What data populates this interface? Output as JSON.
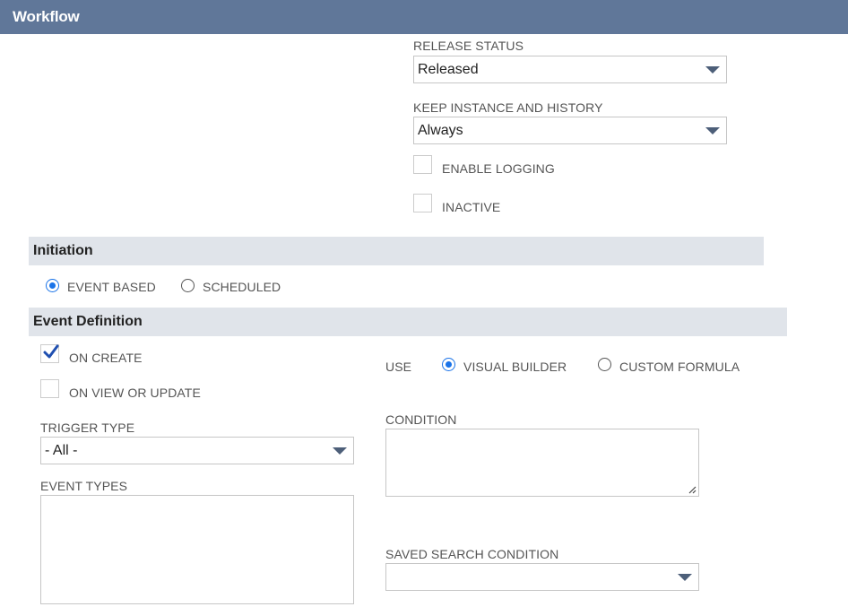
{
  "header": {
    "title": "Workflow"
  },
  "release_status": {
    "label": "RELEASE STATUS",
    "value": "Released"
  },
  "keep_instance": {
    "label": "KEEP INSTANCE AND HISTORY",
    "value": "Always"
  },
  "enable_logging": {
    "label": "ENABLE LOGGING",
    "checked": false
  },
  "inactive": {
    "label": "INACTIVE",
    "checked": false
  },
  "initiation": {
    "title": "Initiation",
    "options": [
      {
        "label": "EVENT BASED",
        "selected": true
      },
      {
        "label": "SCHEDULED",
        "selected": false
      }
    ]
  },
  "event_definition": {
    "title": "Event Definition",
    "on_create": {
      "label": "ON CREATE",
      "checked": true
    },
    "on_view_or_update": {
      "label": "ON VIEW OR UPDATE",
      "checked": false
    },
    "use": {
      "label": "USE",
      "options": [
        {
          "label": "VISUAL BUILDER",
          "selected": true
        },
        {
          "label": "CUSTOM FORMULA",
          "selected": false
        }
      ]
    },
    "trigger_type": {
      "label": "TRIGGER TYPE",
      "value": "- All -"
    },
    "condition": {
      "label": "CONDITION",
      "value": ""
    },
    "event_types": {
      "label": "EVENT TYPES"
    },
    "saved_search_condition": {
      "label": "SAVED SEARCH CONDITION",
      "value": ""
    }
  },
  "colors": {
    "header_bg": "#607799",
    "section_bg": "#e0e4ea",
    "accent": "#1a73e8",
    "caret": "#4d5f79"
  }
}
